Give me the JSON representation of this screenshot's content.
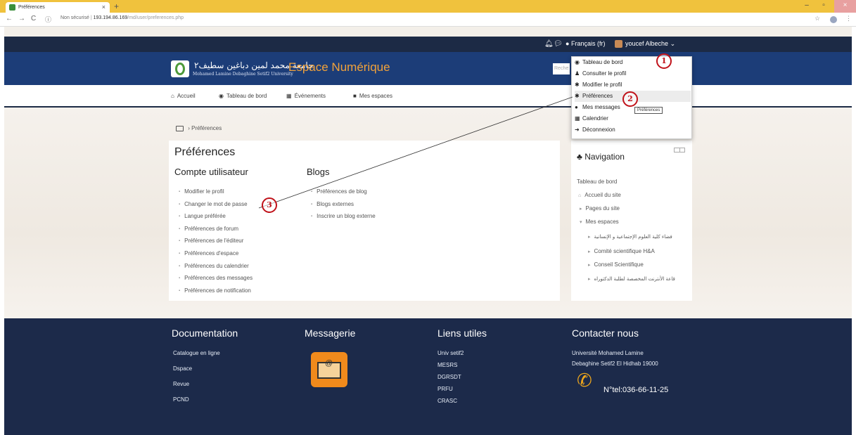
{
  "browser": {
    "tab_title": "Préférences",
    "tab_close": "×",
    "new_tab": "+",
    "url_secure": "Non sécurisé",
    "url_host": "193.194.86.169",
    "url_path": "/md/user/preferences.php",
    "win_min": "–",
    "win_max": "▫",
    "win_close": "×"
  },
  "topbar": {
    "language": "Français (fr)",
    "user_name": "youcef Albeche"
  },
  "header": {
    "logo_arabic": "جامعة محمد لمين دباغين سطيف٢",
    "logo_sub": "Mohamed Lamine Debaghine Setif2 University",
    "site_title": "Espace Numérique",
    "search_placeholder": "Reche"
  },
  "nav": {
    "items": [
      "Accueil",
      "Tableau de bord",
      "Événements",
      "Mes espaces"
    ]
  },
  "breadcrumb": {
    "current": "Préférences"
  },
  "main": {
    "page_title": "Préférences",
    "account_title": "Compte utilisateur",
    "account_links": [
      "Modifier le profil",
      "Changer le mot de passe",
      "Langue préférée",
      "Préférences de forum",
      "Préférences de l'éditeur",
      "Préférences d'espace",
      "Préférences du calendrier",
      "Préférences des messages",
      "Préférences de notification"
    ],
    "blogs_title": "Blogs",
    "blog_links": [
      "Préférences de blog",
      "Blogs externes",
      "Inscrire un blog externe"
    ]
  },
  "navigation_block": {
    "title": "Navigation",
    "dashboard": "Tableau de bord",
    "site_home": "Accueil du site",
    "site_pages": "Pages du site",
    "my_spaces": "Mes espaces",
    "spaces": [
      "فضاء كلية العلوم الإجتماعية و الإنسانية",
      "Comité scientifique H&A",
      "Conseil Scientifique",
      "قاعة الأنترنت المخصصة لطلبة الدكتوراه"
    ]
  },
  "user_menu": {
    "items": [
      "Tableau de bord",
      "Consulter le profil",
      "Modifier le profil",
      "Préférences",
      "Mes messages",
      "Calendrier",
      "Déconnexion"
    ],
    "tooltip": "Préférences"
  },
  "annotations": {
    "markers": [
      "1",
      "2",
      "3"
    ],
    "color": "#c0121a"
  },
  "footer": {
    "documentation_title": "Documentation",
    "documentation_links": [
      "Catalogue en ligne",
      "Dspace",
      "Revue",
      "PCND"
    ],
    "messaging_title": "Messagerie",
    "useful_title": "Liens utiles",
    "useful_links": [
      "Univ setif2",
      "MESRS",
      "DGRSDT",
      "PRFU",
      "CRASC"
    ],
    "contact_title": "Contacter nous",
    "contact_address_1": "Université Mohamed Lamine",
    "contact_address_2": "Debaghine Setif2 El Hidhab 19000",
    "contact_phone": "N°tel:036-66-11-25"
  },
  "colors": {
    "topbar": "#1c2a45",
    "header": "#1c3d78",
    "accent": "#f2a23a",
    "footer": "#1c2a4a",
    "tab_bar": "#f0c23d"
  }
}
